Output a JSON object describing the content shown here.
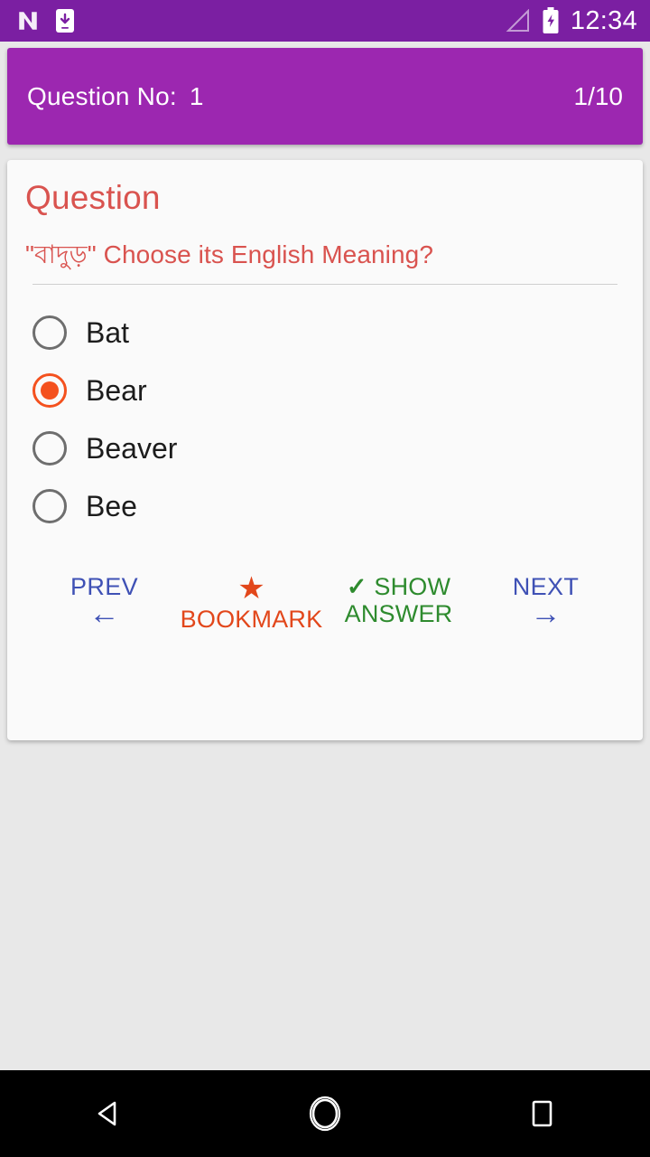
{
  "status_bar": {
    "background": "#7B1FA2",
    "time": "12:34",
    "icons": [
      "android-n-icon",
      "download-to-device-icon",
      "signal-icon",
      "battery-charging-icon"
    ]
  },
  "question_header": {
    "background": "#9C27B0",
    "label": "Question No:",
    "number": "1",
    "progress": "1/10"
  },
  "card": {
    "heading": "Question",
    "accent_color": "#D9534F",
    "question_text": "\"বাদুড়\" Choose its English Meaning?"
  },
  "options": [
    {
      "label": "Bat",
      "selected": false
    },
    {
      "label": "Bear",
      "selected": true
    },
    {
      "label": "Beaver",
      "selected": false
    },
    {
      "label": "Bee",
      "selected": false
    }
  ],
  "selected_color": "#F4511E",
  "actions": {
    "prev": {
      "label": "PREV",
      "arrow": "←",
      "color": "#3F51B5"
    },
    "bookmark": {
      "star": "★",
      "label": "BOOKMARK",
      "color": "#E2471B"
    },
    "show_answer": {
      "check": "✓",
      "line1": "SHOW",
      "line2": "ANSWER",
      "color": "#2E8B2E"
    },
    "next": {
      "label": "NEXT",
      "arrow": "→",
      "color": "#3F51B5"
    }
  },
  "nav_bar": {
    "back": "back-triangle-icon",
    "home": "home-circle-icon",
    "recents": "recents-square-icon"
  }
}
